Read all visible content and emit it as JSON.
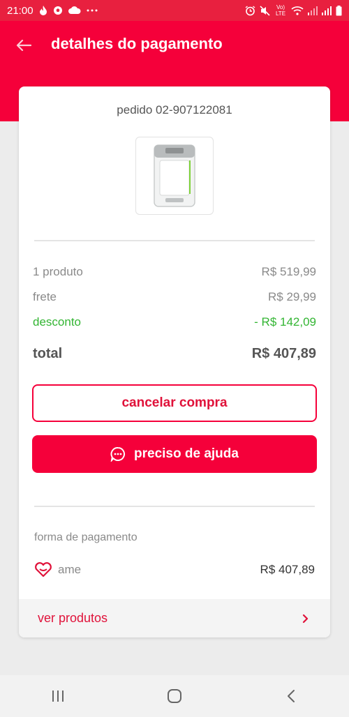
{
  "status_bar": {
    "time": "21:00",
    "network_label": "Vo) LTE"
  },
  "header": {
    "title": "detalhes do pagamento"
  },
  "order": {
    "id_label": "pedido 02-907122081"
  },
  "summary": {
    "products_label": "1 produto",
    "products_value": "R$ 519,99",
    "shipping_label": "frete",
    "shipping_value": "R$ 29,99",
    "discount_label": "desconto",
    "discount_value": "- R$ 142,09",
    "total_label": "total",
    "total_value": "R$ 407,89"
  },
  "actions": {
    "cancel_label": "cancelar compra",
    "help_label": "preciso de ajuda"
  },
  "payment": {
    "section_label": "forma de pagamento",
    "method_name": "ame",
    "amount": "R$ 407,89"
  },
  "footer_link": {
    "label": "ver produtos"
  },
  "colors": {
    "brand_red": "#f5003a",
    "discount_green": "#33b533"
  },
  "icons": [
    "back-arrow-icon",
    "chat-bubble-icon",
    "heart-icon",
    "chevron-right-icon",
    "recent-apps-icon",
    "home-icon",
    "back-icon"
  ]
}
